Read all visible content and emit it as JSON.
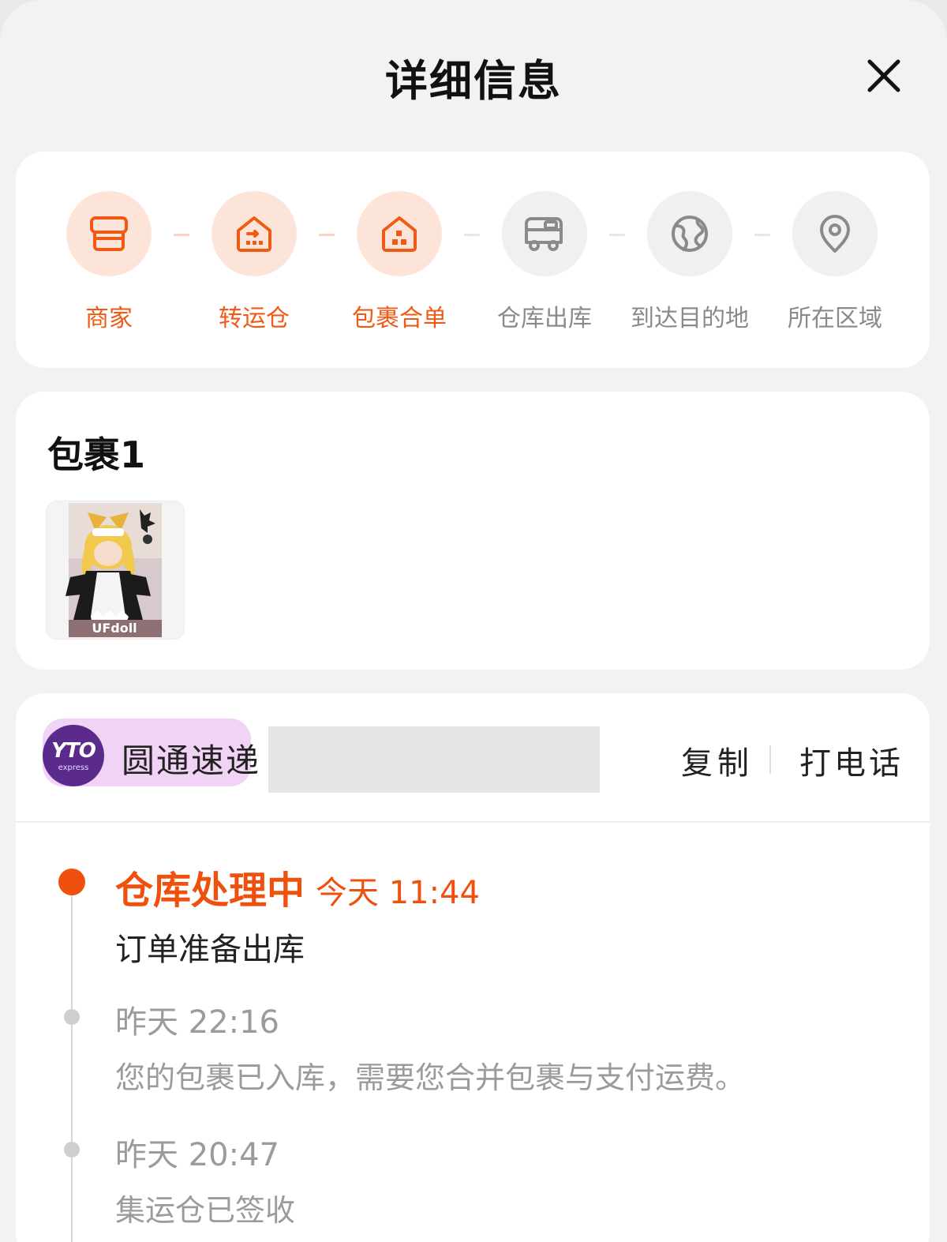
{
  "header": {
    "title": "详细信息"
  },
  "steps": [
    {
      "label": "商家",
      "icon": "storefront-icon",
      "state": "done"
    },
    {
      "label": "转运仓",
      "icon": "transit-warehouse-icon",
      "state": "done"
    },
    {
      "label": "包裹合单",
      "icon": "package-merge-icon",
      "state": "done"
    },
    {
      "label": "仓库出库",
      "icon": "truck-icon",
      "state": "todo"
    },
    {
      "label": "到达目的地",
      "icon": "globe-icon",
      "state": "todo"
    },
    {
      "label": "所在区域",
      "icon": "location-pin-icon",
      "state": "todo"
    }
  ],
  "package": {
    "title": "包裹1",
    "thumbnail_watermark": "UFdoll"
  },
  "carrier": {
    "logo_text": "YTO",
    "logo_subtext": "express",
    "name": "圆通速递",
    "copy_label": "复制",
    "call_label": "打电话"
  },
  "timeline": [
    {
      "status": "仓库处理中",
      "time": "今天 11:44",
      "desc": "订单准备出库"
    },
    {
      "time": "昨天 22:16",
      "desc": "您的包裹已入库，需要您合并包裹与支付运费。"
    },
    {
      "time": "昨天 20:47",
      "desc": "集运仓已签收"
    }
  ],
  "colors": {
    "accent": "#f0500e",
    "step_done_bg": "#fde4d8",
    "step_todo_bg": "#f0f0f0",
    "carrier_purple": "#5b2a8d"
  }
}
